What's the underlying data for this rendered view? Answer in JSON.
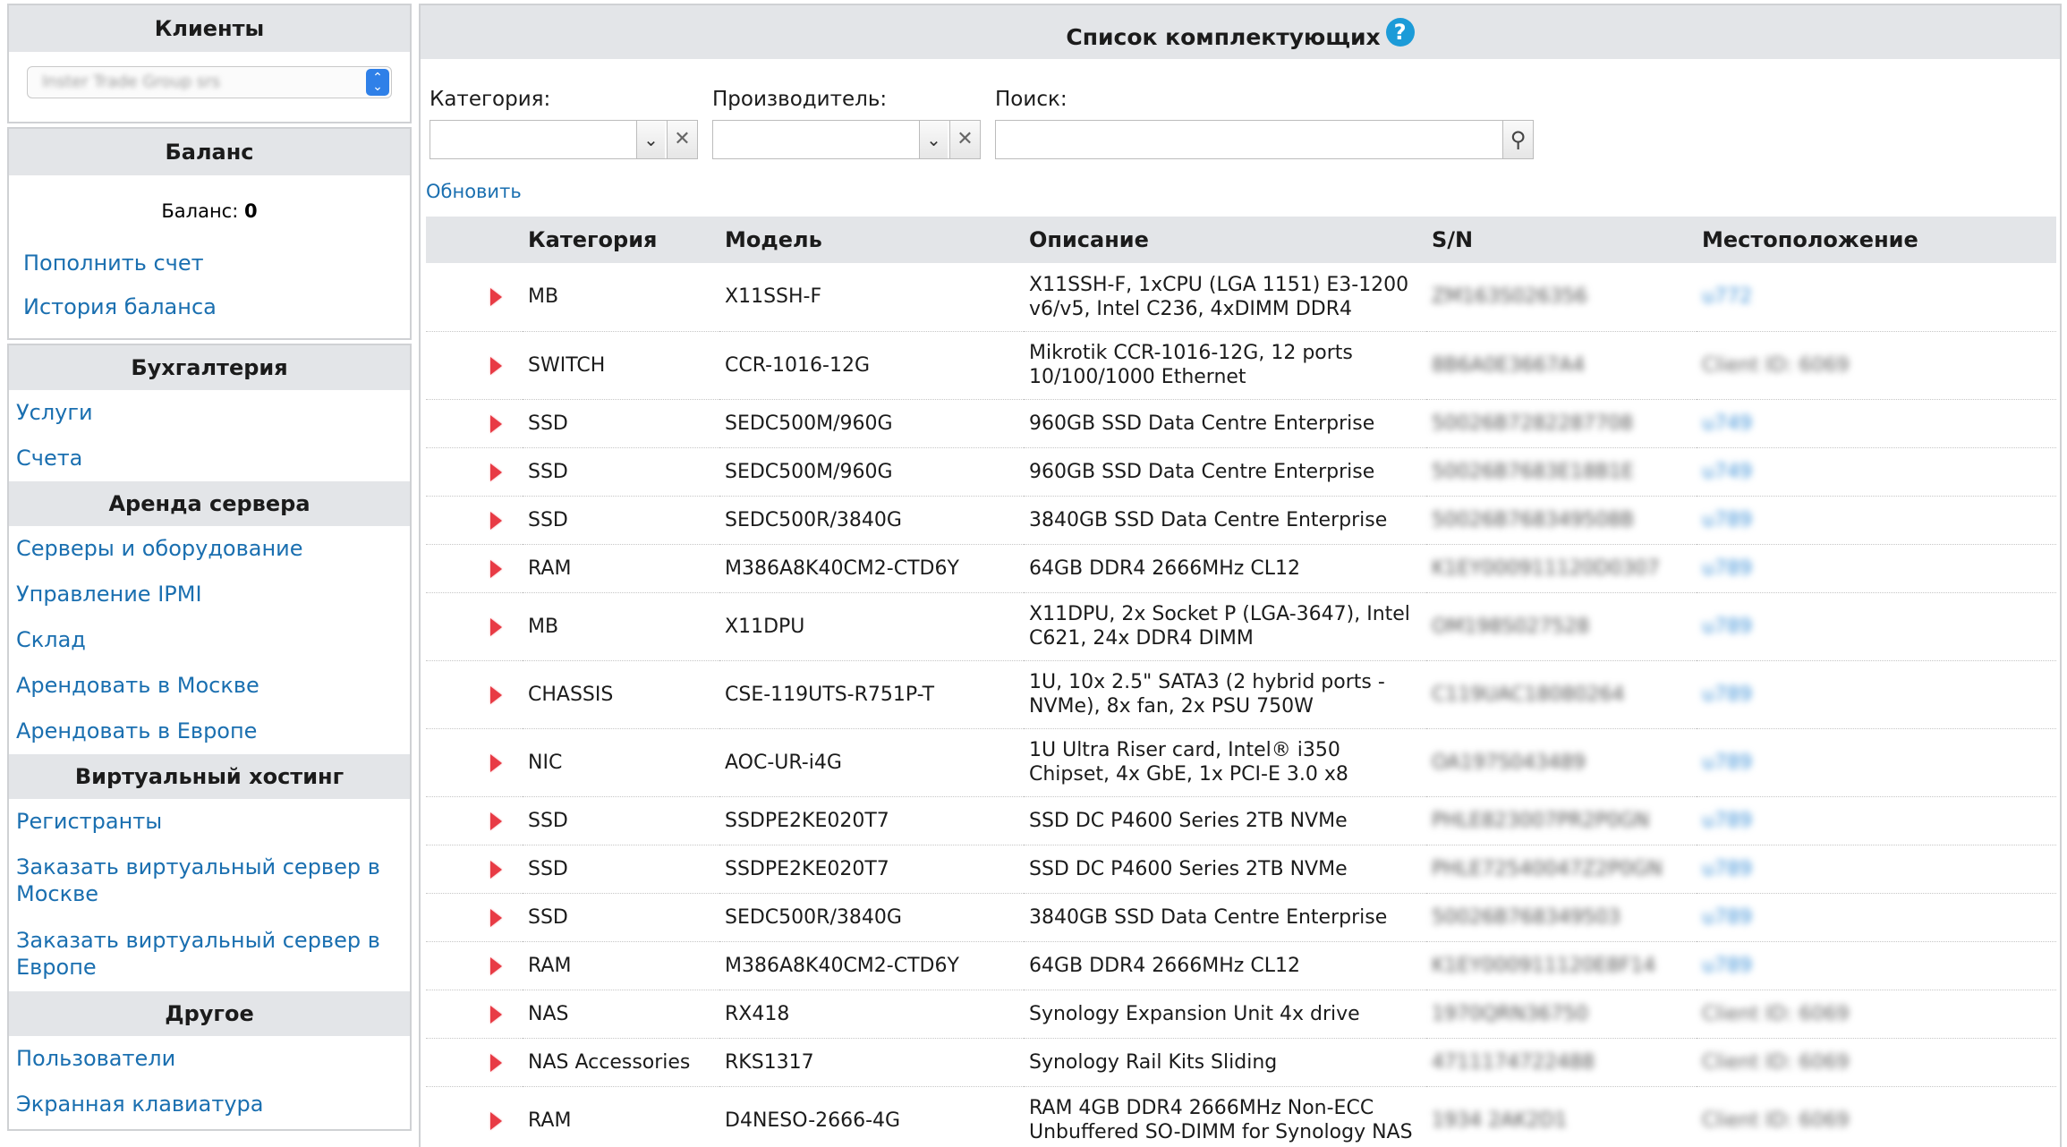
{
  "sidebar": {
    "clients": {
      "title": "Клиенты",
      "selected": "Inster Trade Group srs"
    },
    "balance": {
      "title": "Баланс",
      "label": "Баланс:",
      "value": "0",
      "links": [
        "Пополнить счет",
        "История баланса"
      ]
    },
    "sections": [
      {
        "title": "Бухгалтерия",
        "links": [
          "Услуги",
          "Счета"
        ]
      },
      {
        "title": "Аренда сервера",
        "links": [
          "Серверы и оборудование",
          "Управление IPMI",
          "Склад",
          "Арендовать в Москве",
          "Арендовать в Европе"
        ]
      },
      {
        "title": "Виртуальный хостинг",
        "links": [
          "Регистранты",
          "Заказать виртуальный сервер в Москве",
          "Заказать виртуальный сервер в Европе"
        ]
      },
      {
        "title": "Другое",
        "links": [
          "Пользователи",
          "Экранная клавиатура"
        ]
      }
    ]
  },
  "main": {
    "title": "Список комплектующих",
    "help_icon": "?",
    "filters": {
      "category_label": "Категория:",
      "manufacturer_label": "Производитель:",
      "search_label": "Поиск:",
      "clear_symbol": "✕"
    },
    "refresh_label": "Обновить",
    "columns": [
      "Категория",
      "Модель",
      "Описание",
      "S/N",
      "Местоположение"
    ],
    "rows": [
      {
        "category": "MB",
        "model": "X11SSH-F",
        "description": "X11SSH-F, 1xCPU (LGA 1151) E3-1200 v6/v5, Intel C236, 4xDIMM DDR4",
        "sn": "ZM163S026356",
        "location": "u772",
        "tall": true,
        "client": false
      },
      {
        "category": "SWITCH",
        "model": "CCR-1016-12G",
        "description": "Mikrotik CCR-1016-12G, 12 ports 10/100/1000 Ethernet",
        "sn": "8B6A0E3667A4",
        "location": "Client ID: 6069",
        "tall": true,
        "client": true
      },
      {
        "category": "SSD",
        "model": "SEDC500M/960G",
        "description": "960GB SSD Data Centre Enterprise",
        "sn": "50026B7282287708",
        "location": "u749",
        "tall": false,
        "client": false
      },
      {
        "category": "SSD",
        "model": "SEDC500M/960G",
        "description": "960GB SSD Data Centre Enterprise",
        "sn": "50026B7683E18B1E",
        "location": "u749",
        "tall": false,
        "client": false
      },
      {
        "category": "SSD",
        "model": "SEDC500R/3840G",
        "description": "3840GB SSD Data Centre Enterprise",
        "sn": "50026B768349508B",
        "location": "u789",
        "tall": false,
        "client": false
      },
      {
        "category": "RAM",
        "model": "M386A8K40CM2-CTD6Y",
        "description": "64GB DDR4 2666MHz CL12",
        "sn": "K1EY000911120D0307",
        "location": "u789",
        "tall": false,
        "client": false
      },
      {
        "category": "MB",
        "model": "X11DPU",
        "description": "X11DPU, 2x Socket P (LGA-3647), Intel C621, 24x DDR4 DIMM",
        "sn": "OM198S027528",
        "location": "u789",
        "tall": true,
        "client": false
      },
      {
        "category": "CHASSIS",
        "model": "CSE-119UTS-R751P-T",
        "description": "1U, 10x 2.5\" SATA3 (2 hybrid ports - NVMe), 8x fan, 2x PSU 750W",
        "sn": "C119UAC18080264",
        "location": "u789",
        "tall": true,
        "client": false
      },
      {
        "category": "NIC",
        "model": "AOC-UR-i4G",
        "description": "1U Ultra Riser card, Intel® i350 Chipset, 4x GbE, 1x PCI-E 3.0 x8",
        "sn": "OA197S043489",
        "location": "u789",
        "tall": true,
        "client": false
      },
      {
        "category": "SSD",
        "model": "SSDPE2KE020T7",
        "description": "SSD DC P4600 Series 2TB NVMe",
        "sn": "PHLE823007PR2P0GN",
        "location": "u789",
        "tall": false,
        "client": false
      },
      {
        "category": "SSD",
        "model": "SSDPE2KE020T7",
        "description": "SSD DC P4600 Series 2TB NVMe",
        "sn": "PHLE72540047Z2P0GN",
        "location": "u789",
        "tall": false,
        "client": false
      },
      {
        "category": "SSD",
        "model": "SEDC500R/3840G",
        "description": "3840GB SSD Data Centre Enterprise",
        "sn": "50026B768349503",
        "location": "u789",
        "tall": false,
        "client": false
      },
      {
        "category": "RAM",
        "model": "M386A8K40CM2-CTD6Y",
        "description": "64GB DDR4 2666MHz CL12",
        "sn": "K1EY000911120E8F14",
        "location": "u789",
        "tall": false,
        "client": false
      },
      {
        "category": "NAS",
        "model": "RX418",
        "description": "Synology Expansion Unit 4x drive",
        "sn": "1970QRN36750",
        "location": "Client ID: 6069",
        "tall": false,
        "client": true
      },
      {
        "category": "NAS Accessories",
        "model": "RKS1317",
        "description": "Synology Rail Kits Sliding",
        "sn": "4711174722488",
        "location": "Client ID: 6069",
        "tall": false,
        "client": true
      },
      {
        "category": "RAM",
        "model": "D4NESO-2666-4G",
        "description": "RAM 4GB DDR4 2666MHz Non-ECC Unbuffered SO-DIMM for Synology NAS",
        "sn": "1934 2AK2D1",
        "location": "Client ID: 6069",
        "tall": true,
        "client": true
      }
    ]
  }
}
